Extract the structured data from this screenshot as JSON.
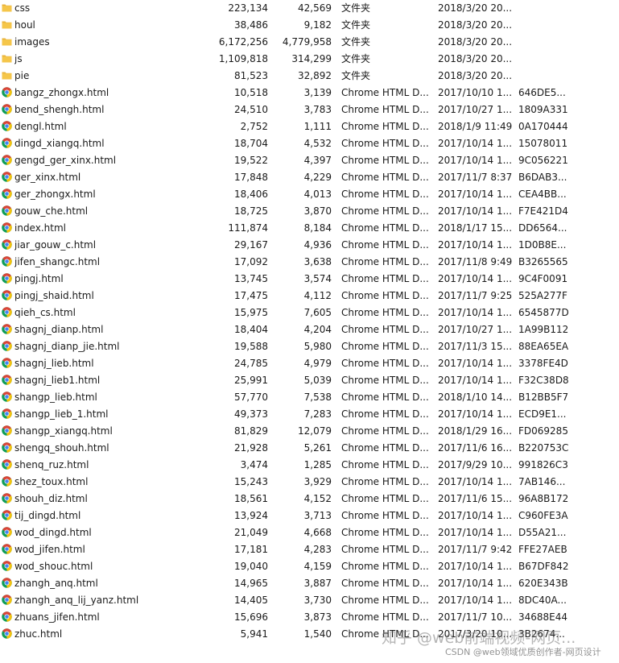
{
  "files": [
    {
      "name": "css",
      "kind": "folder",
      "size": "223,134",
      "packed": "42,569",
      "type": "文件夹",
      "modified": "2018/3/20 20...",
      "crc": ""
    },
    {
      "name": "houl",
      "kind": "folder",
      "size": "38,486",
      "packed": "9,182",
      "type": "文件夹",
      "modified": "2018/3/20 20...",
      "crc": ""
    },
    {
      "name": "images",
      "kind": "folder",
      "size": "6,172,256",
      "packed": "4,779,958",
      "type": "文件夹",
      "modified": "2018/3/20 20...",
      "crc": ""
    },
    {
      "name": "js",
      "kind": "folder",
      "size": "1,109,818",
      "packed": "314,299",
      "type": "文件夹",
      "modified": "2018/3/20 20...",
      "crc": ""
    },
    {
      "name": "pie",
      "kind": "folder",
      "size": "81,523",
      "packed": "32,892",
      "type": "文件夹",
      "modified": "2018/3/20 20...",
      "crc": ""
    },
    {
      "name": "bangz_zhongx.html",
      "kind": "html",
      "size": "10,518",
      "packed": "3,139",
      "type": "Chrome HTML D...",
      "modified": "2017/10/10 1...",
      "crc": "646DE5..."
    },
    {
      "name": "bend_shengh.html",
      "kind": "html",
      "size": "24,510",
      "packed": "3,783",
      "type": "Chrome HTML D...",
      "modified": "2017/10/27 1...",
      "crc": "1809A331"
    },
    {
      "name": "dengl.html",
      "kind": "html",
      "size": "2,752",
      "packed": "1,111",
      "type": "Chrome HTML D...",
      "modified": "2018/1/9 11:49",
      "crc": "0A170444"
    },
    {
      "name": "dingd_xiangq.html",
      "kind": "html",
      "size": "18,704",
      "packed": "4,532",
      "type": "Chrome HTML D...",
      "modified": "2017/10/14 1...",
      "crc": "15078011"
    },
    {
      "name": "gengd_ger_xinx.html",
      "kind": "html",
      "size": "19,522",
      "packed": "4,397",
      "type": "Chrome HTML D...",
      "modified": "2017/10/14 1...",
      "crc": "9C056221"
    },
    {
      "name": "ger_xinx.html",
      "kind": "html",
      "size": "17,848",
      "packed": "4,229",
      "type": "Chrome HTML D...",
      "modified": "2017/11/7 8:37",
      "crc": "B6DAB3..."
    },
    {
      "name": "ger_zhongx.html",
      "kind": "html",
      "size": "18,406",
      "packed": "4,013",
      "type": "Chrome HTML D...",
      "modified": "2017/10/14 1...",
      "crc": "CEA4BB..."
    },
    {
      "name": "gouw_che.html",
      "kind": "html",
      "size": "18,725",
      "packed": "3,870",
      "type": "Chrome HTML D...",
      "modified": "2017/10/14 1...",
      "crc": "F7E421D4"
    },
    {
      "name": "index.html",
      "kind": "html",
      "size": "111,874",
      "packed": "8,184",
      "type": "Chrome HTML D...",
      "modified": "2018/1/17 15...",
      "crc": "DD6564..."
    },
    {
      "name": "jiar_gouw_c.html",
      "kind": "html",
      "size": "29,167",
      "packed": "4,936",
      "type": "Chrome HTML D...",
      "modified": "2017/10/14 1...",
      "crc": "1D0B8E..."
    },
    {
      "name": "jifen_shangc.html",
      "kind": "html",
      "size": "17,092",
      "packed": "3,638",
      "type": "Chrome HTML D...",
      "modified": "2017/11/8 9:49",
      "crc": "B3265565"
    },
    {
      "name": "pingj.html",
      "kind": "html",
      "size": "13,745",
      "packed": "3,574",
      "type": "Chrome HTML D...",
      "modified": "2017/10/14 1...",
      "crc": "9C4F0091"
    },
    {
      "name": "pingj_shaid.html",
      "kind": "html",
      "size": "17,475",
      "packed": "4,112",
      "type": "Chrome HTML D...",
      "modified": "2017/11/7 9:25",
      "crc": "525A277F"
    },
    {
      "name": "qieh_cs.html",
      "kind": "html",
      "size": "15,975",
      "packed": "7,605",
      "type": "Chrome HTML D...",
      "modified": "2017/10/14 1...",
      "crc": "6545877D"
    },
    {
      "name": "shagnj_dianp.html",
      "kind": "html",
      "size": "18,404",
      "packed": "4,204",
      "type": "Chrome HTML D...",
      "modified": "2017/10/27 1...",
      "crc": "1A99B112"
    },
    {
      "name": "shagnj_dianp_jie.html",
      "kind": "html",
      "size": "19,588",
      "packed": "5,980",
      "type": "Chrome HTML D...",
      "modified": "2017/11/3 15...",
      "crc": "88EA65EA"
    },
    {
      "name": "shagnj_lieb.html",
      "kind": "html",
      "size": "24,785",
      "packed": "4,979",
      "type": "Chrome HTML D...",
      "modified": "2017/10/14 1...",
      "crc": "3378FE4D"
    },
    {
      "name": "shagnj_lieb1.html",
      "kind": "html",
      "size": "25,991",
      "packed": "5,039",
      "type": "Chrome HTML D...",
      "modified": "2017/10/14 1...",
      "crc": "F32C38D8"
    },
    {
      "name": "shangp_lieb.html",
      "kind": "html",
      "size": "57,770",
      "packed": "7,538",
      "type": "Chrome HTML D...",
      "modified": "2018/1/10 14...",
      "crc": "B12BB5F7"
    },
    {
      "name": "shangp_lieb_1.html",
      "kind": "html",
      "size": "49,373",
      "packed": "7,283",
      "type": "Chrome HTML D...",
      "modified": "2017/10/14 1...",
      "crc": "ECD9E1..."
    },
    {
      "name": "shangp_xiangq.html",
      "kind": "html",
      "size": "81,829",
      "packed": "12,079",
      "type": "Chrome HTML D...",
      "modified": "2018/1/29 16...",
      "crc": "FD069285"
    },
    {
      "name": "shengq_shouh.html",
      "kind": "html",
      "size": "21,928",
      "packed": "5,261",
      "type": "Chrome HTML D...",
      "modified": "2017/11/6 16...",
      "crc": "B220753C"
    },
    {
      "name": "shenq_ruz.html",
      "kind": "html",
      "size": "3,474",
      "packed": "1,285",
      "type": "Chrome HTML D...",
      "modified": "2017/9/29 10...",
      "crc": "991826C3"
    },
    {
      "name": "shez_toux.html",
      "kind": "html",
      "size": "15,243",
      "packed": "3,929",
      "type": "Chrome HTML D...",
      "modified": "2017/10/14 1...",
      "crc": "7AB146..."
    },
    {
      "name": "shouh_diz.html",
      "kind": "html",
      "size": "18,561",
      "packed": "4,152",
      "type": "Chrome HTML D...",
      "modified": "2017/11/6 15...",
      "crc": "96A8B172"
    },
    {
      "name": "tij_dingd.html",
      "kind": "html",
      "size": "13,924",
      "packed": "3,713",
      "type": "Chrome HTML D...",
      "modified": "2017/10/14 1...",
      "crc": "C960FE3A"
    },
    {
      "name": "wod_dingd.html",
      "kind": "html",
      "size": "21,049",
      "packed": "4,668",
      "type": "Chrome HTML D...",
      "modified": "2017/10/14 1...",
      "crc": "D55A21..."
    },
    {
      "name": "wod_jifen.html",
      "kind": "html",
      "size": "17,181",
      "packed": "4,283",
      "type": "Chrome HTML D...",
      "modified": "2017/11/7 9:42",
      "crc": "FFE27AEB"
    },
    {
      "name": "wod_shouc.html",
      "kind": "html",
      "size": "19,040",
      "packed": "4,159",
      "type": "Chrome HTML D...",
      "modified": "2017/10/14 1...",
      "crc": "B67DF842"
    },
    {
      "name": "zhangh_anq.html",
      "kind": "html",
      "size": "14,965",
      "packed": "3,887",
      "type": "Chrome HTML D...",
      "modified": "2017/10/14 1...",
      "crc": "620E343B"
    },
    {
      "name": "zhangh_anq_lij_yanz.html",
      "kind": "html",
      "size": "14,405",
      "packed": "3,730",
      "type": "Chrome HTML D...",
      "modified": "2017/10/14 1...",
      "crc": "8DC40A..."
    },
    {
      "name": "zhuans_jifen.html",
      "kind": "html",
      "size": "15,696",
      "packed": "3,873",
      "type": "Chrome HTML D...",
      "modified": "2017/11/7 10...",
      "crc": "34688E44"
    },
    {
      "name": "zhuc.html",
      "kind": "html",
      "size": "5,941",
      "packed": "1,540",
      "type": "Chrome HTML D...",
      "modified": "2017/3/20 10...",
      "crc": "3B2674..."
    }
  ],
  "watermark": {
    "main": "知乎 @web前端视频-网页...",
    "sub": "CSDN @web领域优质创作者-网页设计"
  },
  "colors": {
    "folder_body": "#f5c64a",
    "folder_tab": "#e8b23a",
    "chrome_red": "#db4437",
    "chrome_yellow": "#f4c20d",
    "chrome_green": "#0f9d58",
    "chrome_blue": "#4285f4"
  }
}
